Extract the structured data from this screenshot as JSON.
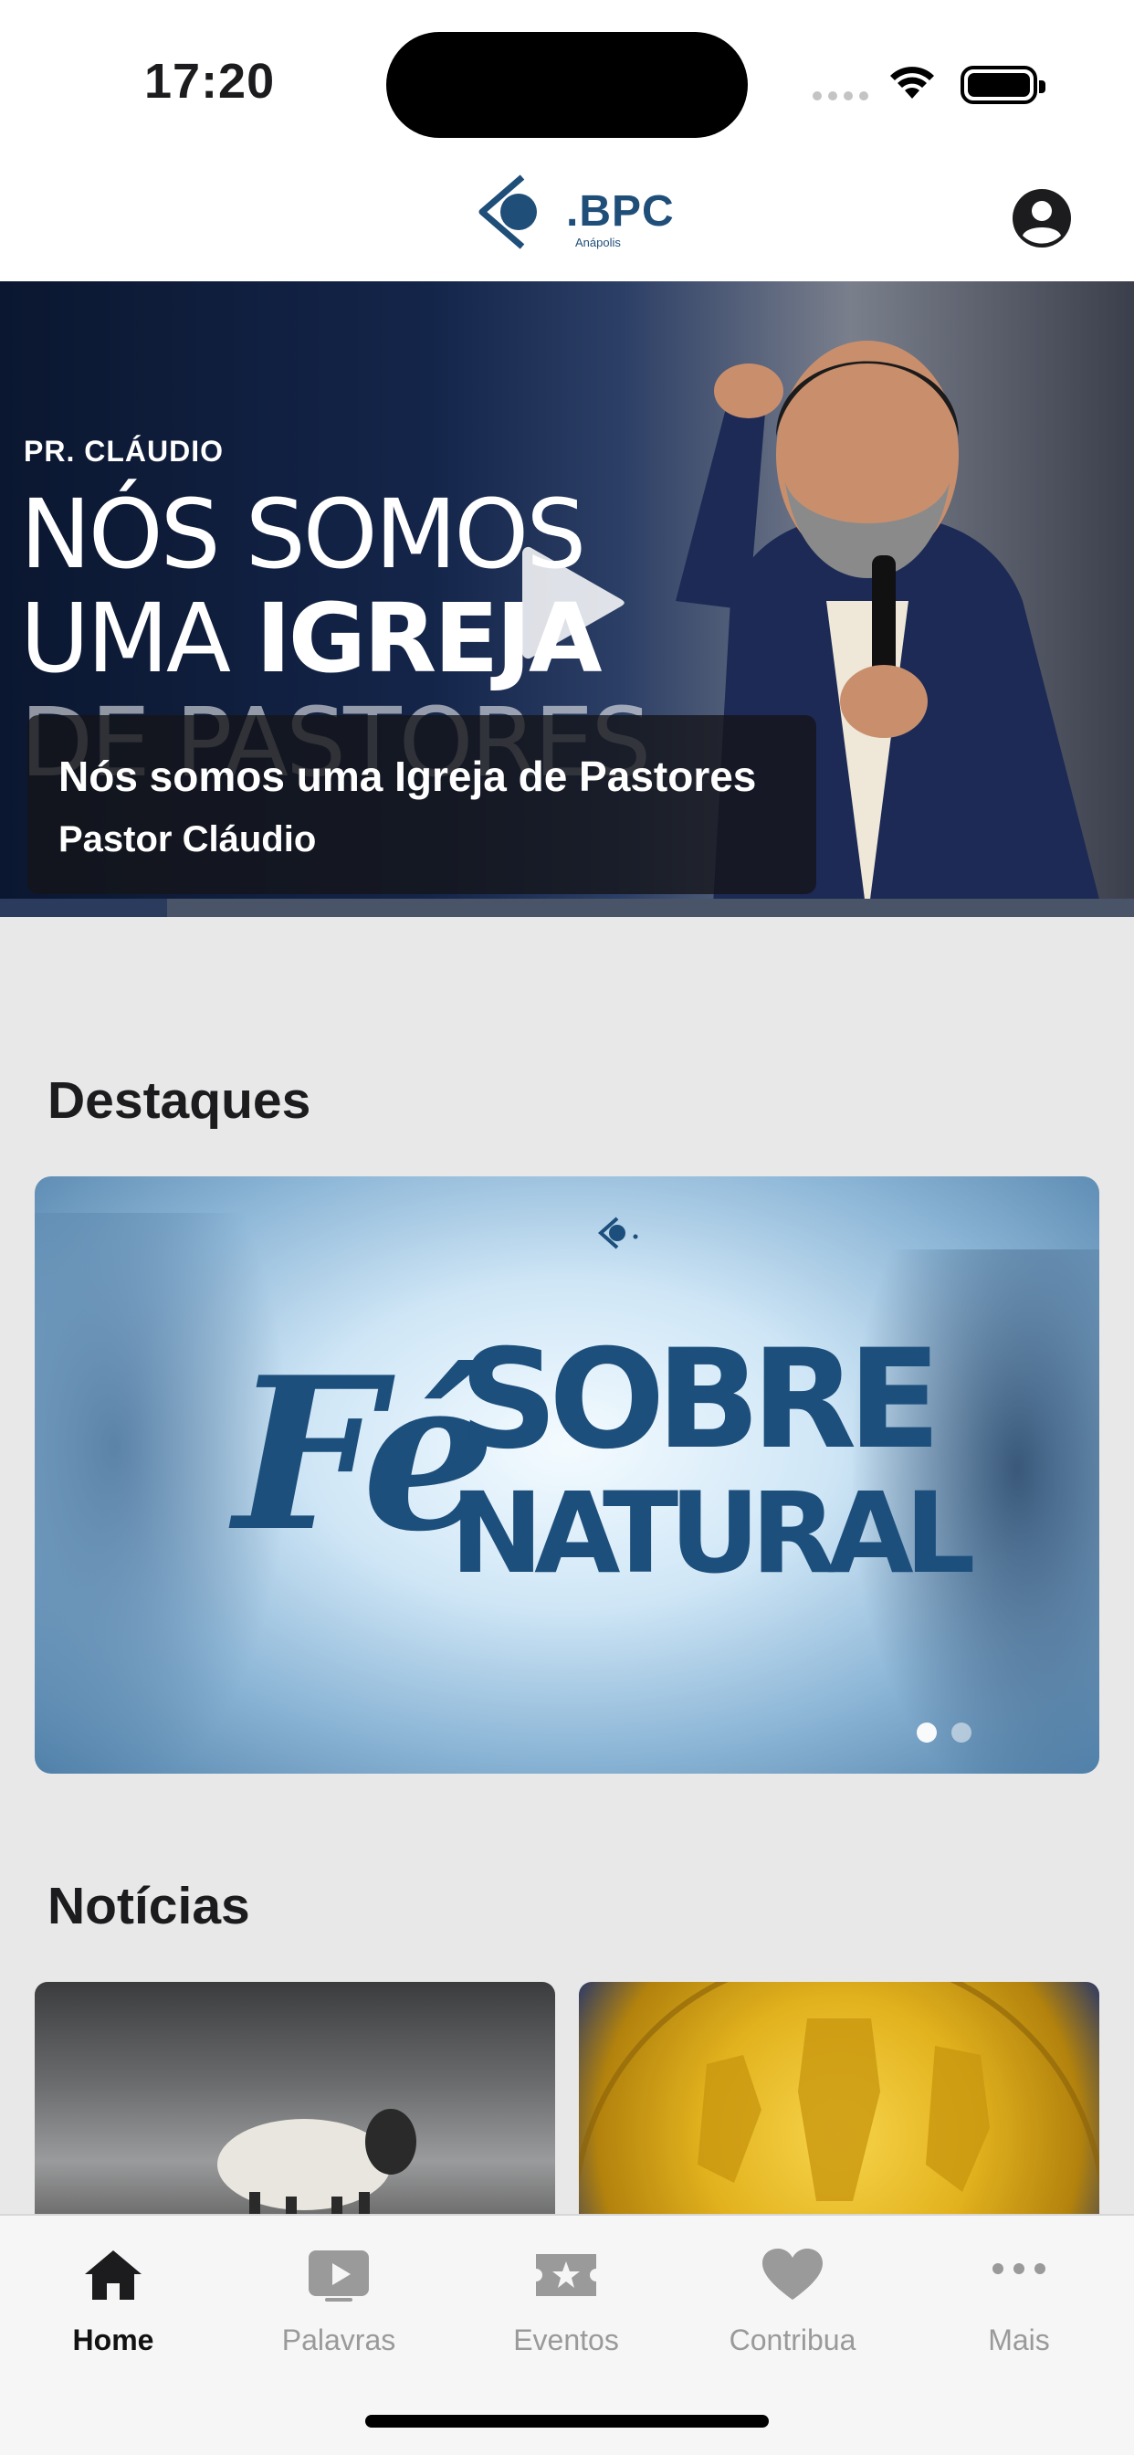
{
  "status_bar": {
    "time": "17:20"
  },
  "header": {
    "logo_text": ".BPC",
    "logo_subtitle": "Anápolis"
  },
  "hero": {
    "thumbnail_tag": "PR. CLÁUDIO",
    "thumbnail_line1": "NÓS SOMOS",
    "thumbnail_line2_a": "UMA ",
    "thumbnail_line2_b": "IGREJA",
    "thumbnail_line3": "DE PASTORES",
    "title": "Nós somos uma Igreja de Pastores",
    "subtitle": "Pastor Cláudio",
    "progress": 0.147
  },
  "highlights": {
    "title": "Destaques",
    "banner": {
      "word1": "Fé",
      "word2": "SOBRE",
      "word3": "NATURAL"
    },
    "pagination": {
      "count": 2,
      "active": 0
    }
  },
  "news": {
    "title": "Notícias"
  },
  "tab_bar": {
    "items": [
      {
        "label": "Home",
        "icon": "home-icon",
        "active": true
      },
      {
        "label": "Palavras",
        "icon": "play-video-icon",
        "active": false
      },
      {
        "label": "Eventos",
        "icon": "star-ticket-icon",
        "active": false
      },
      {
        "label": "Contribua",
        "icon": "heart-icon",
        "active": false
      },
      {
        "label": "Mais",
        "icon": "more-dots-icon",
        "active": false
      }
    ]
  },
  "colors": {
    "brand": "#1f4e79",
    "active_tab": "#111111",
    "inactive_tab": "#9a9a9a"
  }
}
